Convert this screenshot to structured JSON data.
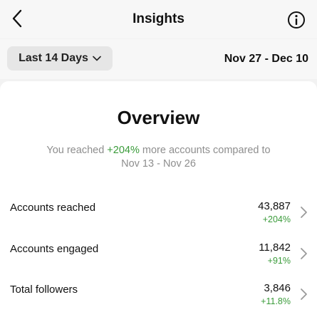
{
  "header": {
    "title": "Insights",
    "back_icon": "chevron-left-icon",
    "info_icon": "info-icon"
  },
  "filter": {
    "range_label": "Last 14 Days",
    "dropdown_icon": "chevron-down-icon",
    "date_range": "Nov 27 - Dec 10"
  },
  "overview": {
    "title": "Overview",
    "summary_prefix": "You reached ",
    "summary_highlight": "+204%",
    "summary_suffix": " more accounts compared to",
    "summary_line2": "Nov 13 - Nov 26"
  },
  "metrics": [
    {
      "label": "Accounts reached",
      "value": "43,887",
      "change": "+204%"
    },
    {
      "label": "Accounts engaged",
      "value": "11,842",
      "change": "+91%"
    },
    {
      "label": "Total followers",
      "value": "3,846",
      "change": "+11.8%"
    }
  ],
  "colors": {
    "positive": "#3a9b3a",
    "muted": "#8e8e8e",
    "page_bg": "#f2f2f2",
    "card_bg": "#ffffff"
  }
}
